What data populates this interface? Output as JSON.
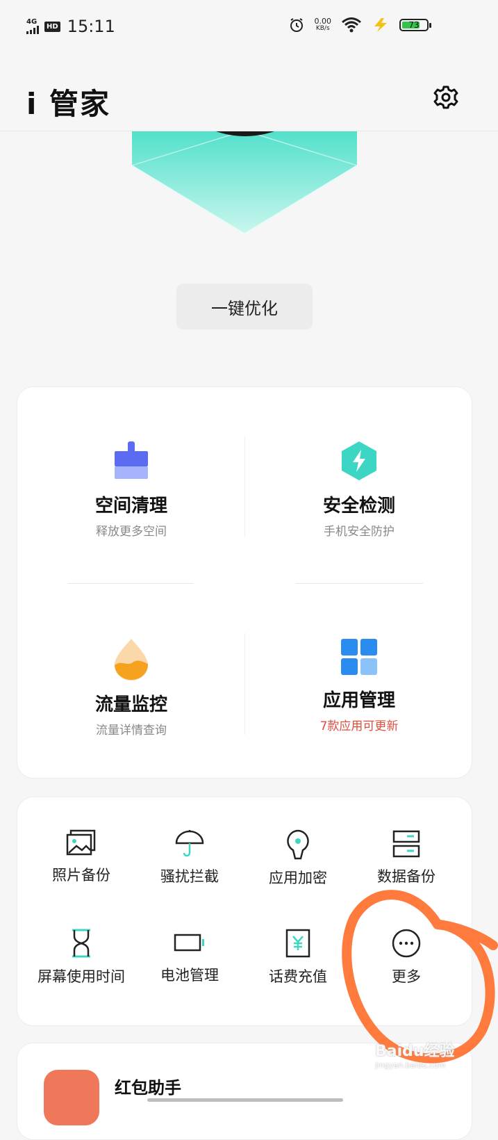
{
  "status_bar": {
    "network": "4G",
    "hd_badge": "HD",
    "time": "15:11",
    "speed_value": "0.00",
    "speed_unit": "KB/s",
    "battery": "73",
    "battery_level": 0.73,
    "battery_fill_color": "#35c24a"
  },
  "header": {
    "title": "i 管家"
  },
  "optimize_button": "一键优化",
  "main_features": [
    {
      "title": "空间清理",
      "subtitle": "释放更多空间",
      "icon": "broom-icon"
    },
    {
      "title": "安全检测",
      "subtitle": "手机安全防护",
      "icon": "shield-bolt-icon"
    },
    {
      "title": "流量监控",
      "subtitle": "流量详情查询",
      "icon": "water-drop-icon"
    },
    {
      "title": "应用管理",
      "subtitle": "7款应用可更新",
      "icon": "app-grid-icon",
      "subtitle_color": "#e14c3d"
    }
  ],
  "tools": [
    {
      "label": "照片备份",
      "icon": "photo-icon"
    },
    {
      "label": "骚扰拦截",
      "icon": "umbrella-icon"
    },
    {
      "label": "应用加密",
      "icon": "lock-key-icon"
    },
    {
      "label": "数据备份",
      "icon": "server-icon"
    },
    {
      "label": "屏幕使用时间",
      "icon": "hourglass-icon"
    },
    {
      "label": "电池管理",
      "icon": "battery-icon"
    },
    {
      "label": "话费充值",
      "icon": "yuan-card-icon"
    },
    {
      "label": "更多",
      "icon": "more-icon"
    }
  ],
  "red_packet": {
    "title": "红包助手",
    "icon": "envelope-icon"
  },
  "watermark": {
    "brand": "Baidu经验",
    "url": "jingyan.baidu.com"
  },
  "colors": {
    "accent_teal": "#3dd6c5",
    "accent_blue": "#2b8cf0",
    "accent_orange": "#f5a21f",
    "annotation": "#ff7a3d"
  }
}
